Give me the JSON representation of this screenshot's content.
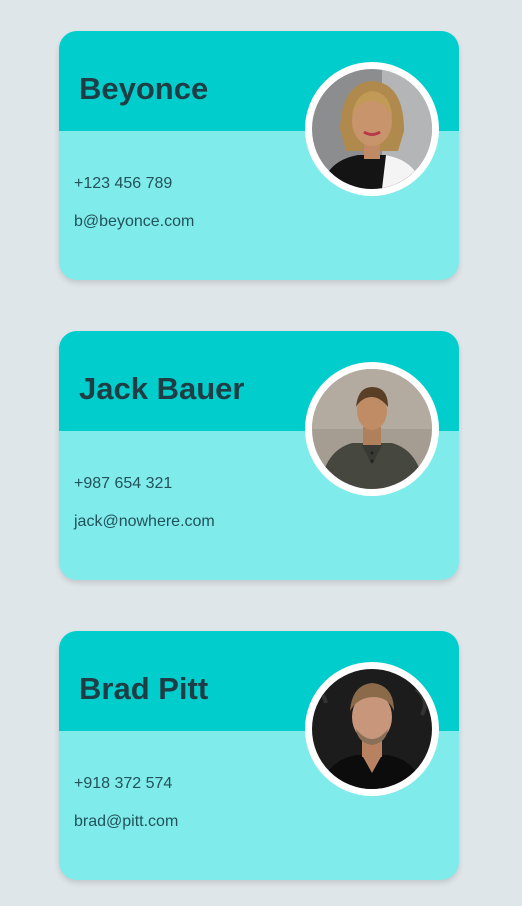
{
  "cards": [
    {
      "name": "Beyonce",
      "phone": "+123 456 789",
      "email": "b@beyonce.com",
      "avatar_icon": "person-photo"
    },
    {
      "name": "Jack Bauer",
      "phone": "+987 654 321",
      "email": "jack@nowhere.com",
      "avatar_icon": "person-photo"
    },
    {
      "name": "Brad Pitt",
      "phone": "+918 372 574",
      "email": "brad@pitt.com",
      "avatar_icon": "person-photo"
    }
  ],
  "colors": {
    "page_background": "#dfe6ea",
    "card_header": "#00cdcc",
    "card_body": "#80ebeb",
    "name_text": "#1e3d44",
    "detail_text": "#22525a"
  }
}
